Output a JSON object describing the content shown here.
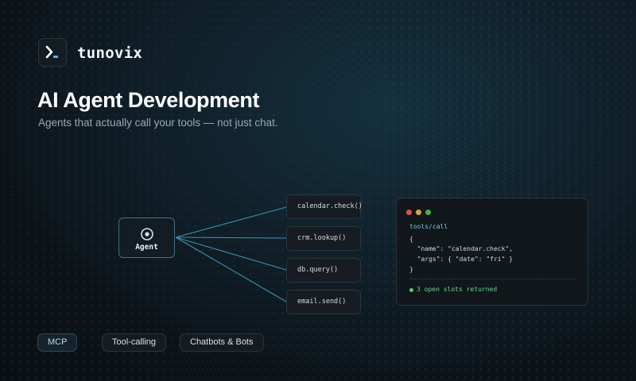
{
  "brand": {
    "name": "tunovix",
    "logo_icon": "terminal-prompt-icon",
    "accent": "#4db8e8"
  },
  "hero": {
    "title": "AI Agent Development",
    "subtitle": "Agents that actually call your tools — not just chat."
  },
  "diagram": {
    "agent_label": "Agent",
    "agent_icon": "target-icon",
    "tools": [
      "calendar.check()",
      "crm.lookup()",
      "db.query()",
      "email.send()"
    ],
    "connector_color": "#3f8fb3"
  },
  "code_panel": {
    "window_dots": [
      "#e0504a",
      "#d9a23a",
      "#4cae4a"
    ],
    "endpoint": "tools/call",
    "lines": [
      "{",
      "  \"name\": \"calendar.check\",",
      "  \"args\": { \"date\": \"fri\" }",
      "}"
    ],
    "status_text": "3 open slots returned",
    "status_color": "#54c978"
  },
  "tags": [
    {
      "label": "MCP",
      "active": true
    },
    {
      "label": "Tool-calling",
      "active": false
    },
    {
      "label": "Chatbots & Bots",
      "active": false
    }
  ]
}
